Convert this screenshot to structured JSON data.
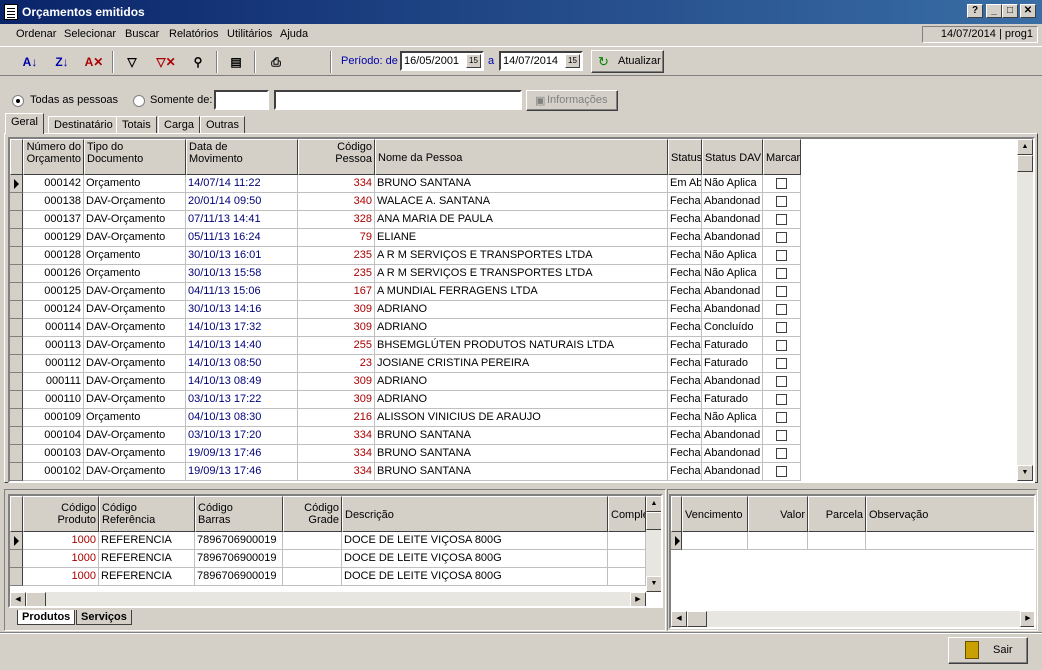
{
  "window": {
    "title": "Orçamentos emitidos",
    "status_date_user": "14/07/2014 | prog1"
  },
  "caption_buttons": [
    "?",
    "_",
    "□",
    "✕"
  ],
  "menu": [
    {
      "label": "Ordenar"
    },
    {
      "label": "Selecionar"
    },
    {
      "label": "Buscar"
    },
    {
      "label": "Relatórios"
    },
    {
      "label": "Utilitários"
    },
    {
      "label": "Ajuda"
    }
  ],
  "toolbar": {
    "period_label": "Período: de",
    "date_from": "16/05/2001",
    "date_sep": "a",
    "date_to": "14/07/2014",
    "refresh_label": "Atualizar",
    "cal_glyph": "15"
  },
  "filter": {
    "all_people_label": "Todas as pessoas",
    "only_label": "Somente de:",
    "code_value": "",
    "name_value": "",
    "info_label": "Informações"
  },
  "tabs": [
    {
      "label": "Geral"
    },
    {
      "label": "Destinatário"
    },
    {
      "label": "Totais"
    },
    {
      "label": "Carga"
    },
    {
      "label": "Outras"
    }
  ],
  "main_grid": {
    "headers": {
      "numero": "Número do\nOrçamento",
      "tipo": "Tipo do\nDocumento",
      "data": "Data de\nMovimento",
      "codigo": "Código\nPessoa",
      "nome": "Nome da Pessoa",
      "status": "Status",
      "status_dav": "Status DAV",
      "marcar": "Marcar"
    },
    "rows": [
      {
        "numero": "000142",
        "tipo": "Orçamento",
        "data": "14/07/14 11:22",
        "codigo": "334",
        "nome": "BRUNO SANTANA",
        "status": "Em Ab",
        "status_dav": "Não Aplica"
      },
      {
        "numero": "000138",
        "tipo": "DAV-Orçamento",
        "data": "20/01/14 09:50",
        "codigo": "340",
        "nome": "WALACE A. SANTANA",
        "status": "Fecha",
        "status_dav": "Abandonad"
      },
      {
        "numero": "000137",
        "tipo": "DAV-Orçamento",
        "data": "07/11/13 14:41",
        "codigo": "328",
        "nome": "ANA MARIA DE PAULA",
        "status": "Fecha",
        "status_dav": "Abandonad"
      },
      {
        "numero": "000129",
        "tipo": "DAV-Orçamento",
        "data": "05/11/13 16:24",
        "codigo": "79",
        "nome": "ELIANE",
        "status": "Fecha",
        "status_dav": "Abandonad"
      },
      {
        "numero": "000128",
        "tipo": "Orçamento",
        "data": "30/10/13 16:01",
        "codigo": "235",
        "nome": "A R M SERVIÇOS E TRANSPORTES LTDA",
        "status": "Fecha",
        "status_dav": "Não Aplica"
      },
      {
        "numero": "000126",
        "tipo": "Orçamento",
        "data": "30/10/13 15:58",
        "codigo": "235",
        "nome": "A R M SERVIÇOS E TRANSPORTES LTDA",
        "status": "Fecha",
        "status_dav": "Não Aplica"
      },
      {
        "numero": "000125",
        "tipo": "DAV-Orçamento",
        "data": "04/11/13 15:06",
        "codigo": "167",
        "nome": "A MUNDIAL FERRAGENS LTDA",
        "status": "Fecha",
        "status_dav": "Abandonad"
      },
      {
        "numero": "000124",
        "tipo": "DAV-Orçamento",
        "data": "30/10/13 14:16",
        "codigo": "309",
        "nome": "ADRIANO",
        "status": "Fecha",
        "status_dav": "Abandonad"
      },
      {
        "numero": "000114",
        "tipo": "DAV-Orçamento",
        "data": "14/10/13 17:32",
        "codigo": "309",
        "nome": "ADRIANO",
        "status": "Fecha",
        "status_dav": "Concluído"
      },
      {
        "numero": "000113",
        "tipo": "DAV-Orçamento",
        "data": "14/10/13 14:40",
        "codigo": "255",
        "nome": "BHSEMGLÚTEN PRODUTOS NATURAIS LTDA",
        "status": "Fecha",
        "status_dav": "Faturado"
      },
      {
        "numero": "000112",
        "tipo": "DAV-Orçamento",
        "data": "14/10/13 08:50",
        "codigo": "23",
        "nome": "JOSIANE CRISTINA PEREIRA",
        "status": "Fecha",
        "status_dav": "Faturado"
      },
      {
        "numero": "000111",
        "tipo": "DAV-Orçamento",
        "data": "14/10/13 08:49",
        "codigo": "309",
        "nome": "ADRIANO",
        "status": "Fecha",
        "status_dav": "Abandonad"
      },
      {
        "numero": "000110",
        "tipo": "DAV-Orçamento",
        "data": "03/10/13 17:22",
        "codigo": "309",
        "nome": "ADRIANO",
        "status": "Fecha",
        "status_dav": "Faturado"
      },
      {
        "numero": "000109",
        "tipo": "Orçamento",
        "data": "04/10/13 08:30",
        "codigo": "216",
        "nome": "ALISSON VINICIUS DE ARAUJO",
        "status": "Fecha",
        "status_dav": "Não Aplica"
      },
      {
        "numero": "000104",
        "tipo": "DAV-Orçamento",
        "data": "03/10/13 17:20",
        "codigo": "334",
        "nome": "BRUNO SANTANA",
        "status": "Fecha",
        "status_dav": "Abandonad"
      },
      {
        "numero": "000103",
        "tipo": "DAV-Orçamento",
        "data": "19/09/13 17:46",
        "codigo": "334",
        "nome": "BRUNO SANTANA",
        "status": "Fecha",
        "status_dav": "Abandonad"
      },
      {
        "numero": "000102",
        "tipo": "DAV-Orçamento",
        "data": "19/09/13 17:46",
        "codigo": "334",
        "nome": "BRUNO SANTANA",
        "status": "Fecha",
        "status_dav": "Abandonad"
      }
    ]
  },
  "items_grid": {
    "headers": {
      "cod_produto": "Código\nProduto",
      "cod_ref": "Código\nReferência",
      "cod_barras": "Código\nBarras",
      "cod_grade": "Código\nGrade",
      "descricao": "Descrição",
      "compl": "Comple"
    },
    "rows": [
      {
        "cod_produto": "1000",
        "cod_ref": "REFERENCIA",
        "cod_barras": "7896706900019",
        "cod_grade": "",
        "descricao": "DOCE DE LEITE VIÇOSA 800G",
        "compl": ""
      },
      {
        "cod_produto": "1000",
        "cod_ref": "REFERENCIA",
        "cod_barras": "7896706900019",
        "cod_grade": "",
        "descricao": "DOCE DE LEITE VIÇOSA 800G",
        "compl": ""
      },
      {
        "cod_produto": "1000",
        "cod_ref": "REFERENCIA",
        "cod_barras": "7896706900019",
        "cod_grade": "",
        "descricao": "DOCE DE LEITE VIÇOSA 800G",
        "compl": ""
      }
    ]
  },
  "bottom_tabs": [
    {
      "label": "Produtos"
    },
    {
      "label": "Serviços"
    }
  ],
  "payments_grid": {
    "headers": {
      "vencimento": "Vencimento",
      "valor": "Valor",
      "parcela": "Parcela",
      "observacao": "Observação"
    }
  },
  "exit_label": "Sair",
  "colors": {
    "title_start": "#0a246a",
    "title_end": "#3a6ea5",
    "face": "#d4d0c8",
    "code_red": "#aa0000",
    "date_navy": "#00007a"
  }
}
